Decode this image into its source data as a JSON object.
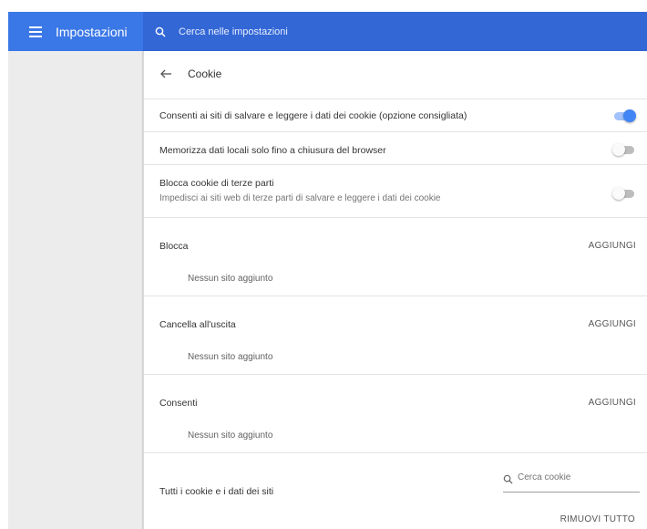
{
  "topbar": {
    "title": "Impostazioni",
    "menu_icon": "hamburger-menu-icon",
    "search_icon": "search-icon",
    "search_placeholder": "Cerca nelle impostazioni"
  },
  "page": {
    "back_icon": "arrow-back-icon",
    "title": "Cookie"
  },
  "settings": [
    {
      "label": "Consenti ai siti di salvare e leggere i dati dei cookie (opzione consigliata)",
      "enabled": true
    },
    {
      "label": "Memorizza dati locali solo fino a chiusura del browser",
      "enabled": false
    },
    {
      "label": "Blocca cookie di terze parti",
      "sublabel": "Impedisci ai siti web di terze parti di salvare e leggere i dati dei cookie",
      "enabled": false
    }
  ],
  "lists": [
    {
      "title": "Blocca",
      "add_label": "AGGIUNGI",
      "empty_text": "Nessun sito aggiunto"
    },
    {
      "title": "Cancella all'uscita",
      "add_label": "AGGIUNGI",
      "empty_text": "Nessun sito aggiunto"
    },
    {
      "title": "Consenti",
      "add_label": "AGGIUNGI",
      "empty_text": "Nessun sito aggiunto"
    }
  ],
  "all_cookies": {
    "title": "Tutti i cookie e i dati dei siti",
    "search_placeholder": "Cerca cookie",
    "remove_all_label": "RIMUOVI TUTTO"
  },
  "colors": {
    "header_left": "#3b78e7",
    "header_right": "#3367d6",
    "toggle_on": "#4285f4",
    "sidebar": "#ececec"
  }
}
